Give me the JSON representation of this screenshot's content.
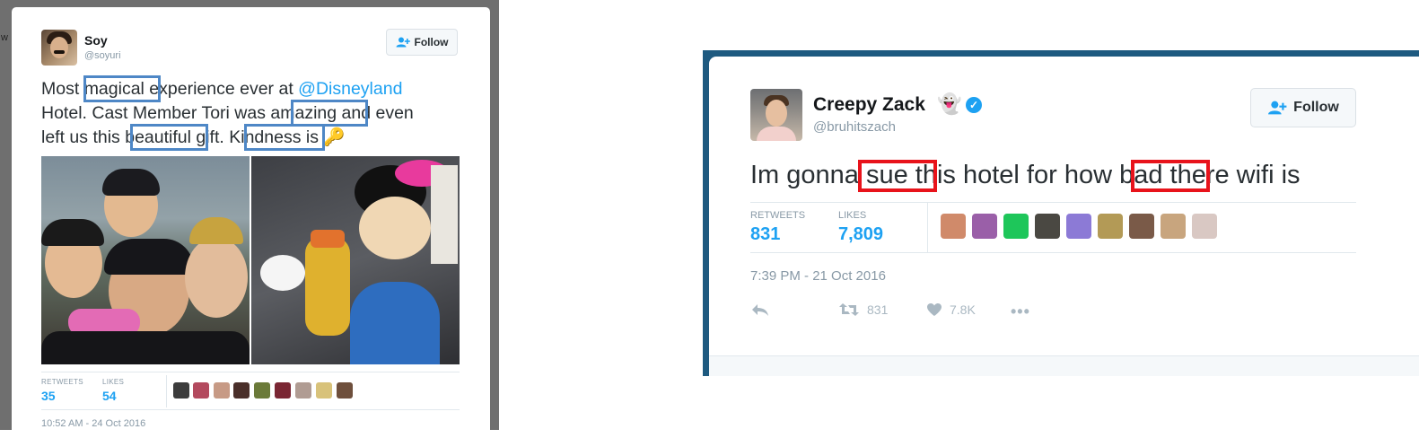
{
  "left_tweet": {
    "author_name": "Soy",
    "author_handle": "@soyuri",
    "follow_label": "Follow",
    "text_lines": [
      [
        "Most ",
        "magical",
        " experience ever at ",
        "@Disneyland"
      ],
      [
        "Hotel. Cast Member Tori was ",
        "amazing",
        " and even"
      ],
      [
        "left us this ",
        "beautiful",
        " gift. ",
        "Kindness",
        " is"
      ]
    ],
    "line1": {
      "a": "Most ",
      "hl": "magical",
      "b": " experience ever at ",
      "mention": "@Disneyland"
    },
    "line2": {
      "a": "Hotel. Cast Member Tori was ",
      "hl": "amazing",
      "b": " and even"
    },
    "line3": {
      "a": "left us this ",
      "hl1": "beautiful",
      "b": " gift. ",
      "hl2": "Kindness",
      "c": " is "
    },
    "key_emoji": "🔑",
    "highlighted_words": [
      "magical",
      "amazing",
      "beautiful",
      "Kindness"
    ],
    "highlight_color": "#4e87c6",
    "retweets_label": "RETWEETS",
    "retweets_value": "35",
    "likes_label": "LIKES",
    "likes_value": "54",
    "timestamp": "10:52 AM - 24 Oct 2016"
  },
  "right_tweet": {
    "author_name": "Creepy Zack",
    "ghost_emoji": "👻",
    "verified_icon": "✓",
    "author_handle": "@bruhitszach",
    "follow_label": "Follow",
    "text": "Im gonna sue this hotel for how bad there wifi is",
    "highlighted_words": [
      "sue",
      "bad"
    ],
    "highlight_color": "#e8131b",
    "retweets_label": "RETWEETS",
    "retweets_value": "831",
    "likes_label": "LIKES",
    "likes_value": "7,809",
    "timestamp": "7:39 PM - 21 Oct 2016",
    "actions": {
      "reply_icon": "reply-icon",
      "retweet_count": "831",
      "like_count": "7.8K",
      "more_icon": "•••"
    }
  },
  "colors": {
    "link": "#1da1f2",
    "text": "#292f33",
    "muted": "#8899a6",
    "left_background": "#6f6f6f",
    "right_background": "#1e5a80"
  }
}
